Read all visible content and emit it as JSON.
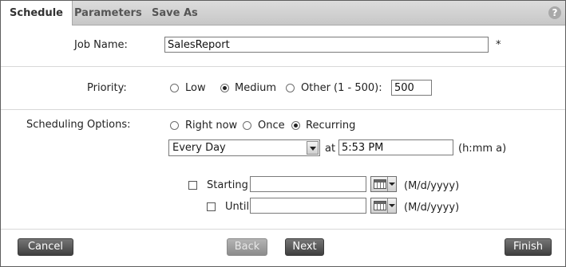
{
  "tabs": [
    {
      "label": "Schedule",
      "active": true
    },
    {
      "label": "Parameters",
      "active": false
    },
    {
      "label": "Save As",
      "active": false
    }
  ],
  "help_symbol": "?",
  "job": {
    "label": "Job Name:",
    "value": "SalesReport",
    "required_mark": "*"
  },
  "priority": {
    "label": "Priority:",
    "options": [
      {
        "label": "Low",
        "selected": false
      },
      {
        "label": "Medium",
        "selected": true
      },
      {
        "label": "Other (1 - 500):",
        "selected": false
      }
    ],
    "other_value": "500"
  },
  "scheduling": {
    "label": "Scheduling Options:",
    "options": [
      {
        "label": "Right now",
        "selected": false
      },
      {
        "label": "Once",
        "selected": false
      },
      {
        "label": "Recurring",
        "selected": true
      }
    ],
    "frequency": "Every Day",
    "at_label": "at",
    "time_value": "5:53 PM",
    "time_format": "(h:mm a)",
    "starting": {
      "label": "Starting",
      "checked": false,
      "value": "",
      "format": "(M/d/yyyy)"
    },
    "until": {
      "label": "Until",
      "checked": false,
      "value": "",
      "format": "(M/d/yyyy)"
    }
  },
  "buttons": {
    "cancel": "Cancel",
    "back": "Back",
    "next": "Next",
    "finish": "Finish"
  }
}
